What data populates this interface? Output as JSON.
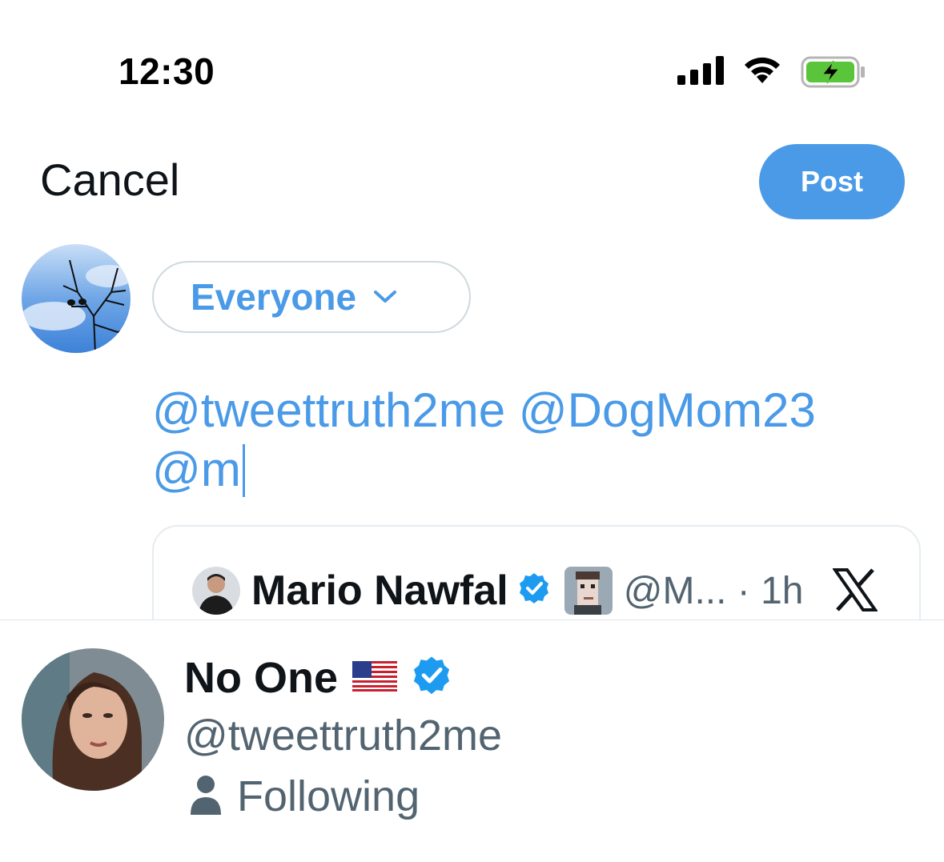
{
  "status_bar": {
    "time": "12:30"
  },
  "header": {
    "cancel_label": "Cancel",
    "post_label": "Post"
  },
  "audience": {
    "label": "Everyone"
  },
  "compose": {
    "line1": "@tweettruth2me @DogMom23",
    "line2": "@m"
  },
  "quoted_post": {
    "author_name": "Mario Nawfal",
    "handle_time": "@M... · 1h"
  },
  "mention_suggestion": {
    "name": "No One",
    "handle": "@tweettruth2me",
    "relation": "Following"
  },
  "colors": {
    "accent": "#4a9ae8",
    "verified": "#1d9bf0",
    "text": "#0f1419",
    "muted": "#536471"
  },
  "icons": [
    "signal-icon",
    "wifi-icon",
    "battery-icon",
    "chevron-down-icon",
    "verified-icon",
    "x-logo-icon",
    "us-flag-icon",
    "person-icon"
  ]
}
